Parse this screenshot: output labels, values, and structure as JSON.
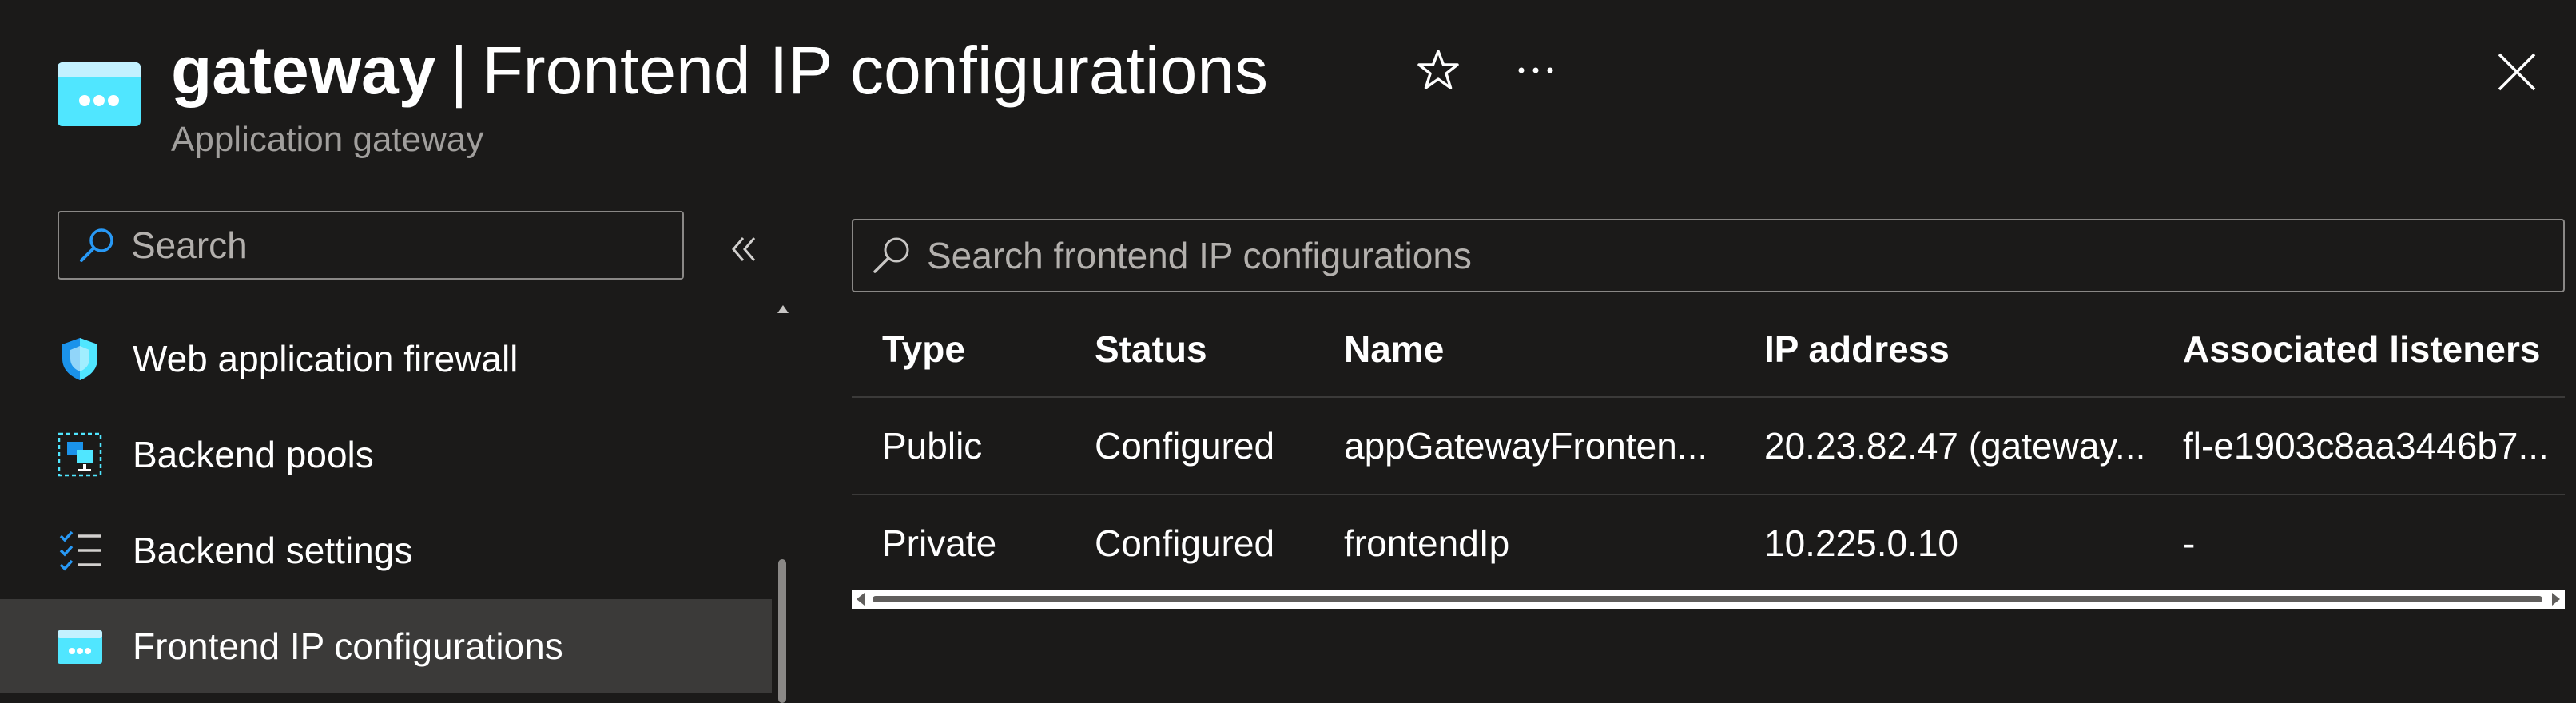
{
  "header": {
    "resource_name": "gateway",
    "separator": "|",
    "page_title": "Frontend IP configurations",
    "subtitle": "Application gateway",
    "icons": {
      "app": "application-gateway-icon",
      "favorite": "star-icon",
      "more": "more-icon",
      "close": "close-icon"
    }
  },
  "sidebar": {
    "search_placeholder": "Search",
    "items": [
      {
        "label": "Web application firewall",
        "icon": "shield-icon",
        "selected": false
      },
      {
        "label": "Backend pools",
        "icon": "backend-pools-icon",
        "selected": false
      },
      {
        "label": "Backend settings",
        "icon": "checklist-icon",
        "selected": false
      },
      {
        "label": "Frontend IP configurations",
        "icon": "frontend-ip-icon",
        "selected": true
      }
    ]
  },
  "main": {
    "search_placeholder": "Search frontend IP configurations",
    "columns": [
      "Type",
      "Status",
      "Name",
      "IP address",
      "Associated listeners"
    ],
    "rows": [
      [
        "Public",
        "Configured",
        "appGatewayFronten...",
        "20.23.82.47 (gateway...",
        "fl-e1903c8aa3446b7..."
      ],
      [
        "Private",
        "Configured",
        "frontendIp",
        "10.225.0.10",
        "-"
      ]
    ]
  },
  "colors": {
    "background": "#1b1a19",
    "selected_nav": "#3b3a39",
    "accent_blue": "#50e6ff",
    "search_icon_blue": "#2899f5",
    "subtle_text": "#a19f9d"
  }
}
